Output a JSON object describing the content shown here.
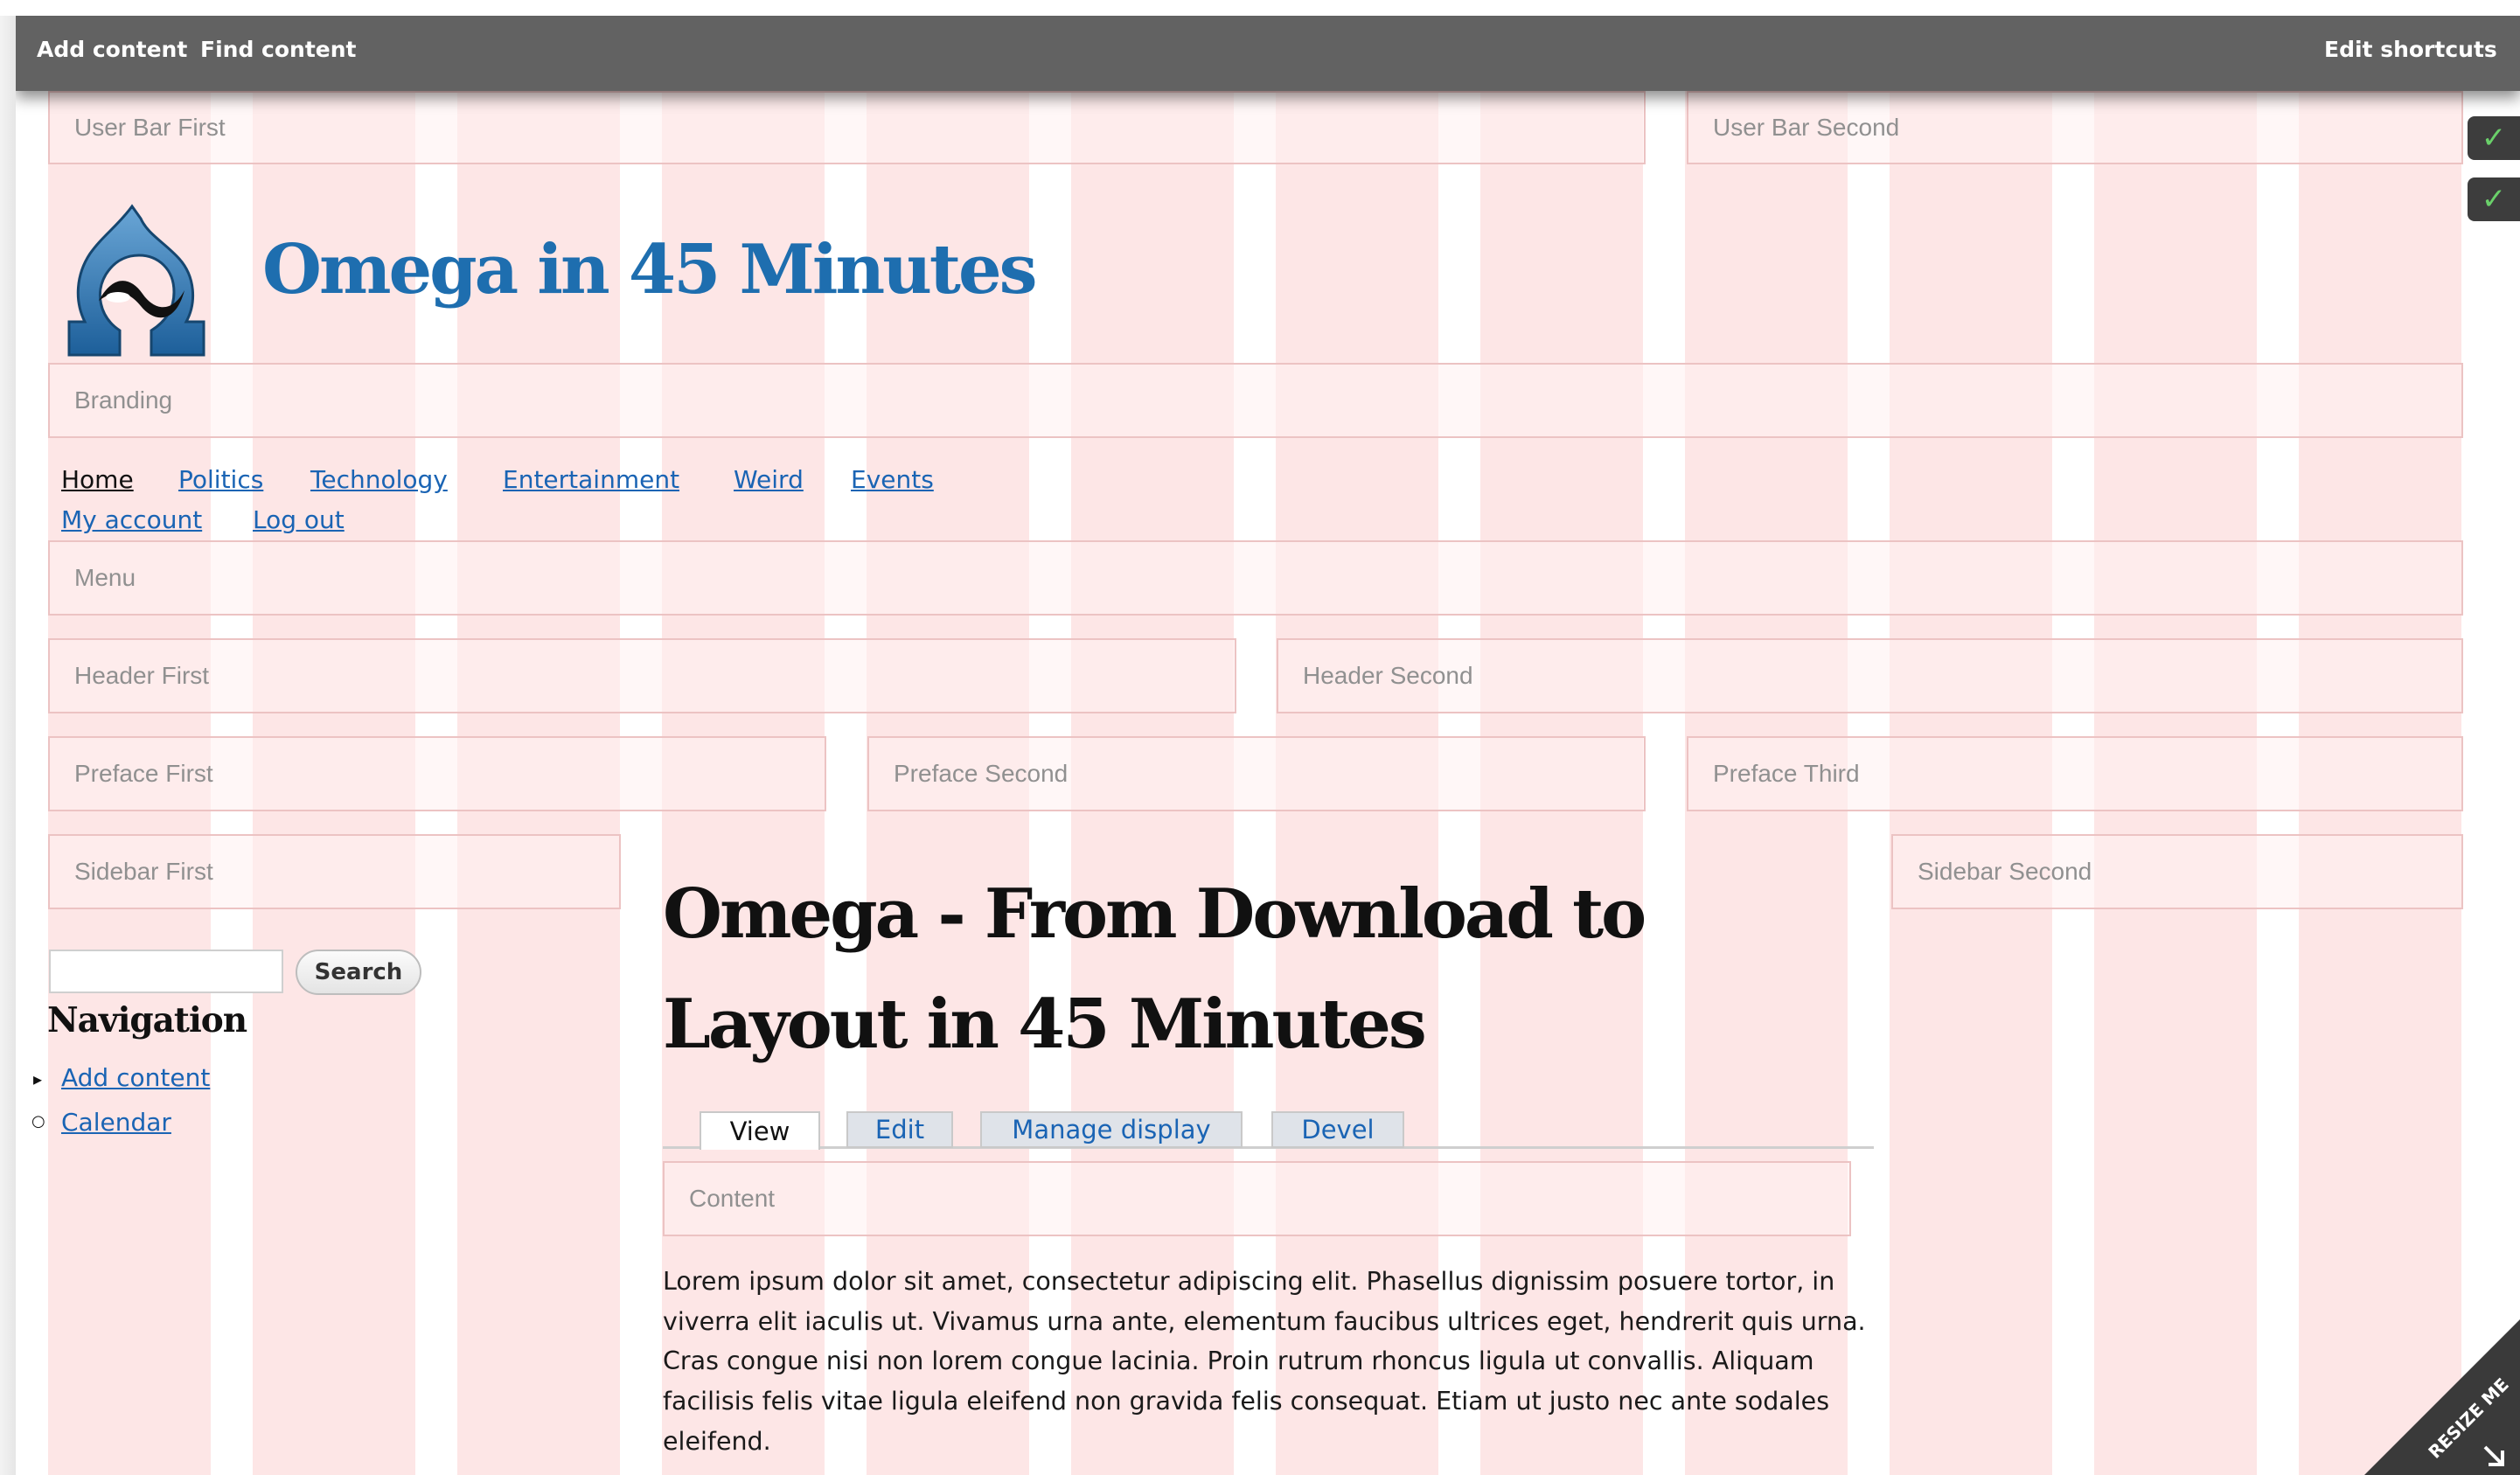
{
  "toolbar": {
    "add_content": "Add content",
    "find_content": "Find content",
    "edit_shortcuts": "Edit shortcuts"
  },
  "regions": {
    "user_bar_first": "User Bar First",
    "user_bar_second": "User Bar Second",
    "branding": "Branding",
    "menu": "Menu",
    "header_first": "Header First",
    "header_second": "Header Second",
    "preface_first": "Preface First",
    "preface_second": "Preface Second",
    "preface_third": "Preface Third",
    "sidebar_first": "Sidebar First",
    "sidebar_second": "Sidebar Second",
    "content": "Content"
  },
  "site": {
    "name": "Omega in 45 Minutes"
  },
  "main_menu": [
    "Home",
    "Politics",
    "Technology",
    "Entertainment",
    "Weird",
    "Events"
  ],
  "secondary_menu": [
    "My account",
    "Log out"
  ],
  "search": {
    "button": "Search"
  },
  "navigation": {
    "heading": "Navigation",
    "items": [
      "Add content",
      "Calendar"
    ]
  },
  "node": {
    "title_line1": "Omega - From Download to",
    "title_line2": "Layout in 45 Minutes",
    "tabs": [
      "View",
      "Edit",
      "Manage display",
      "Devel"
    ],
    "body": "Lorem ipsum dolor sit amet, consectetur adipiscing elit. Phasellus dignissim posuere tortor, in viverra elit iaculis ut. Vivamus urna ante, elementum faucibus ultrices eget, hendrerit quis urna. Cras congue nisi non lorem congue lacinia. Proin rutrum rhoncus ligula ut convallis. Aliquam facilisis felis vitae ligula eleifend non gravida felis consequat. Etiam ut justo nec ante sodales eleifend."
  },
  "resize_label": "RESIZE ME",
  "colors": {
    "grid_column": "#fde6e6",
    "toolbar": "#626262",
    "site_name": "#1e6eaf",
    "link": "#1a64b4"
  }
}
